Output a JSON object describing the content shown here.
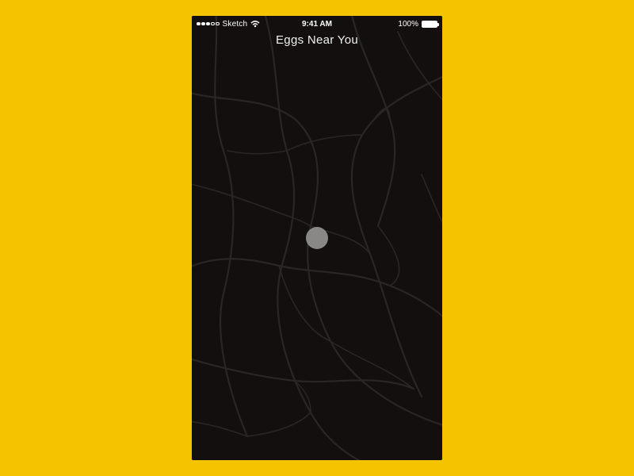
{
  "status_bar": {
    "carrier": "Sketch",
    "time": "9:41 AM",
    "battery_pct": "100%"
  },
  "page": {
    "title": "Eggs Near You"
  },
  "colors": {
    "page_bg": "#f5c400",
    "phone_bg": "#130f0f",
    "road": "#2b2626",
    "location_dot": "#8a8787"
  }
}
